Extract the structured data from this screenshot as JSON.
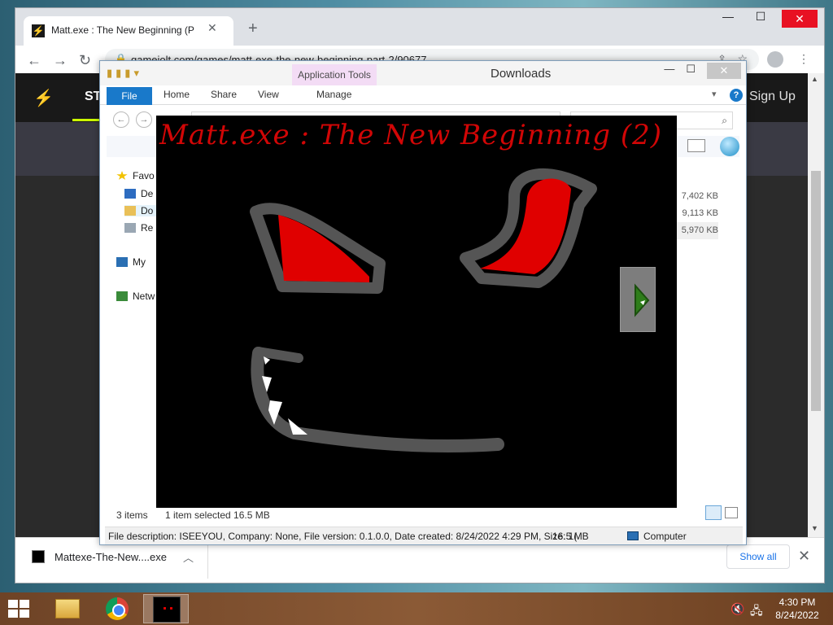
{
  "browser": {
    "tab_title": "Matt.exe : The New Beginning (P",
    "url": "gamejolt.com/games/matt-exe-the-new-beginning-part-2/90677",
    "page": {
      "nav_partial": "ST",
      "signup": "Sign Up"
    },
    "download": {
      "filename": "Mattexe-The-New....exe",
      "show_all": "Show all"
    }
  },
  "explorer": {
    "title": "Downloads",
    "app_tools": "Application Tools",
    "ribbon_tabs": [
      "File",
      "Home",
      "Share",
      "View",
      "Manage"
    ],
    "sidebar": {
      "favorites": "Favo",
      "desktop": "De",
      "downloads": "Do",
      "recent": "Re",
      "my_computer": "My",
      "network": "Netw"
    },
    "sizes": [
      "7,402 KB",
      "9,113 KB",
      "5,970 KB"
    ],
    "status": {
      "items": "3 items",
      "selected": "1 item selected  16.5 MB"
    },
    "details": {
      "text": "File description: ISEEYOU, Company: None, File version: 0.1.0.0, Date created: 8/24/2022 4:29 PM, Size: 1(",
      "size": "16.5 MB",
      "location": "Computer"
    }
  },
  "game": {
    "title": "Matt.exe : The New Beginning (2)"
  },
  "taskbar": {
    "time": "4:30 PM",
    "date": "8/24/2022"
  },
  "colors": {
    "game_red": "#d10606",
    "explorer_accent": "#1979ca",
    "gamejolt_accent": "#ccff00"
  }
}
